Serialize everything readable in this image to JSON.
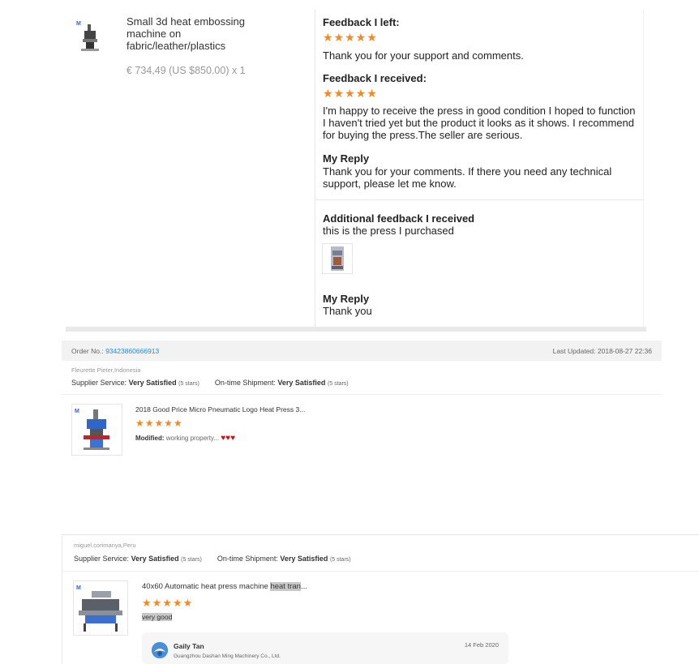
{
  "item1": {
    "title": "Small 3d heat embossing machine on fabric/leather/plastics",
    "price": "€ 734,49 (US $850.00) x 1",
    "feedback_left_label": "Feedback I left:",
    "feedback_left_stars": "★★★★★",
    "feedback_left_text": "Thank you for your support and comments.",
    "feedback_received_label": "Feedback I received:",
    "feedback_received_stars": "★★★★★",
    "feedback_received_text": "I'm happy to receive the press in good condition I hoped to function I haven't tried yet but the product it looks as it shows. I recommend for buying the press.The seller are serious.",
    "my_reply_label": "My Reply",
    "my_reply_text": "Thank you for your comments. If there you need any technical support, please let me know.",
    "additional_label": "Additional feedback I received",
    "additional_text": "this is the press I purchased",
    "my_reply2_label": "My Reply",
    "my_reply2_text": "Thank you"
  },
  "order2": {
    "order_no_label": "Order No.:",
    "order_no": "93423860666913",
    "last_updated": "Last Updated: 2018-08-27 22:36",
    "buyer": "Fleurette Pieter,Indonesia",
    "supplier_service_label": "Supplier Service:",
    "supplier_service_value": "Very Satisfied",
    "supplier_service_stars": "(5 stars)",
    "shipment_label": "On-time Shipment:",
    "shipment_value": "Very Satisfied",
    "shipment_stars": "(5 stars)",
    "product_title": "2018 Good Price Micro Pneumatic Logo Heat Press 3...",
    "stars": "★★★★★",
    "modified_label": "Modified:",
    "modified_text": "working property...",
    "hearts": "♥♥♥"
  },
  "order3": {
    "buyer": "miguel.corimanya,Peru",
    "supplier_service_label": "Supplier Service:",
    "supplier_service_value": "Very Satisfied",
    "supplier_service_stars": "(5 stars)",
    "shipment_label": "On-time Shipment:",
    "shipment_value": "Very Satisfied",
    "shipment_stars": "(5 stars)",
    "product_title_a": "40x60 Automatic heat press machine",
    "product_title_b": "heat tran",
    "product_title_c": "...",
    "stars": "★★★★★",
    "review_text": "very good",
    "reply_name": "Gaily Tan",
    "reply_company": "Guangzhou Dashan Ming Machinery Co., Ltd.",
    "reply_date": "14 Feb 2020"
  },
  "colors": {
    "star": "#f5891f",
    "link": "#1f8dd6",
    "heart": "#c0161b"
  }
}
